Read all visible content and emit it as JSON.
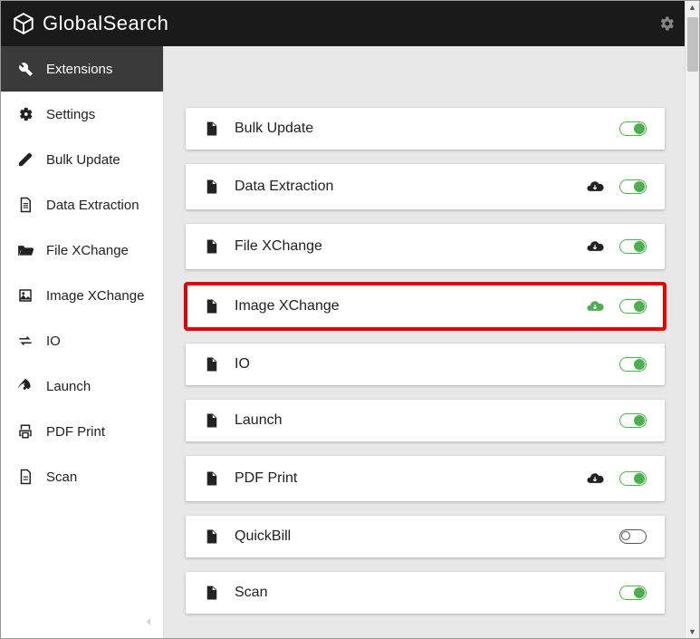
{
  "brand": "GlobalSearch",
  "sidebar": {
    "items": [
      {
        "label": "Extensions",
        "icon": "wrench-icon",
        "active": true
      },
      {
        "label": "Settings",
        "icon": "gear-icon"
      },
      {
        "label": "Bulk Update",
        "icon": "edit-icon"
      },
      {
        "label": "Data Extraction",
        "icon": "document-lines-icon"
      },
      {
        "label": "File XChange",
        "icon": "folder-open-icon"
      },
      {
        "label": "Image XChange",
        "icon": "image-icon"
      },
      {
        "label": "IO",
        "icon": "transfer-icon"
      },
      {
        "label": "Launch",
        "icon": "rocket-icon"
      },
      {
        "label": "PDF Print",
        "icon": "print-icon"
      },
      {
        "label": "Scan",
        "icon": "page-icon"
      }
    ]
  },
  "extensions": [
    {
      "label": "Bulk Update",
      "cloud": null,
      "enabled": true
    },
    {
      "label": "Data Extraction",
      "cloud": "black",
      "enabled": true
    },
    {
      "label": "File XChange",
      "cloud": "black",
      "enabled": true
    },
    {
      "label": "Image XChange",
      "cloud": "green",
      "enabled": true,
      "highlight": true
    },
    {
      "label": "IO",
      "cloud": null,
      "enabled": true
    },
    {
      "label": "Launch",
      "cloud": null,
      "enabled": true
    },
    {
      "label": "PDF Print",
      "cloud": "black",
      "enabled": true
    },
    {
      "label": "QuickBill",
      "cloud": null,
      "enabled": false
    },
    {
      "label": "Scan",
      "cloud": null,
      "enabled": true
    }
  ]
}
